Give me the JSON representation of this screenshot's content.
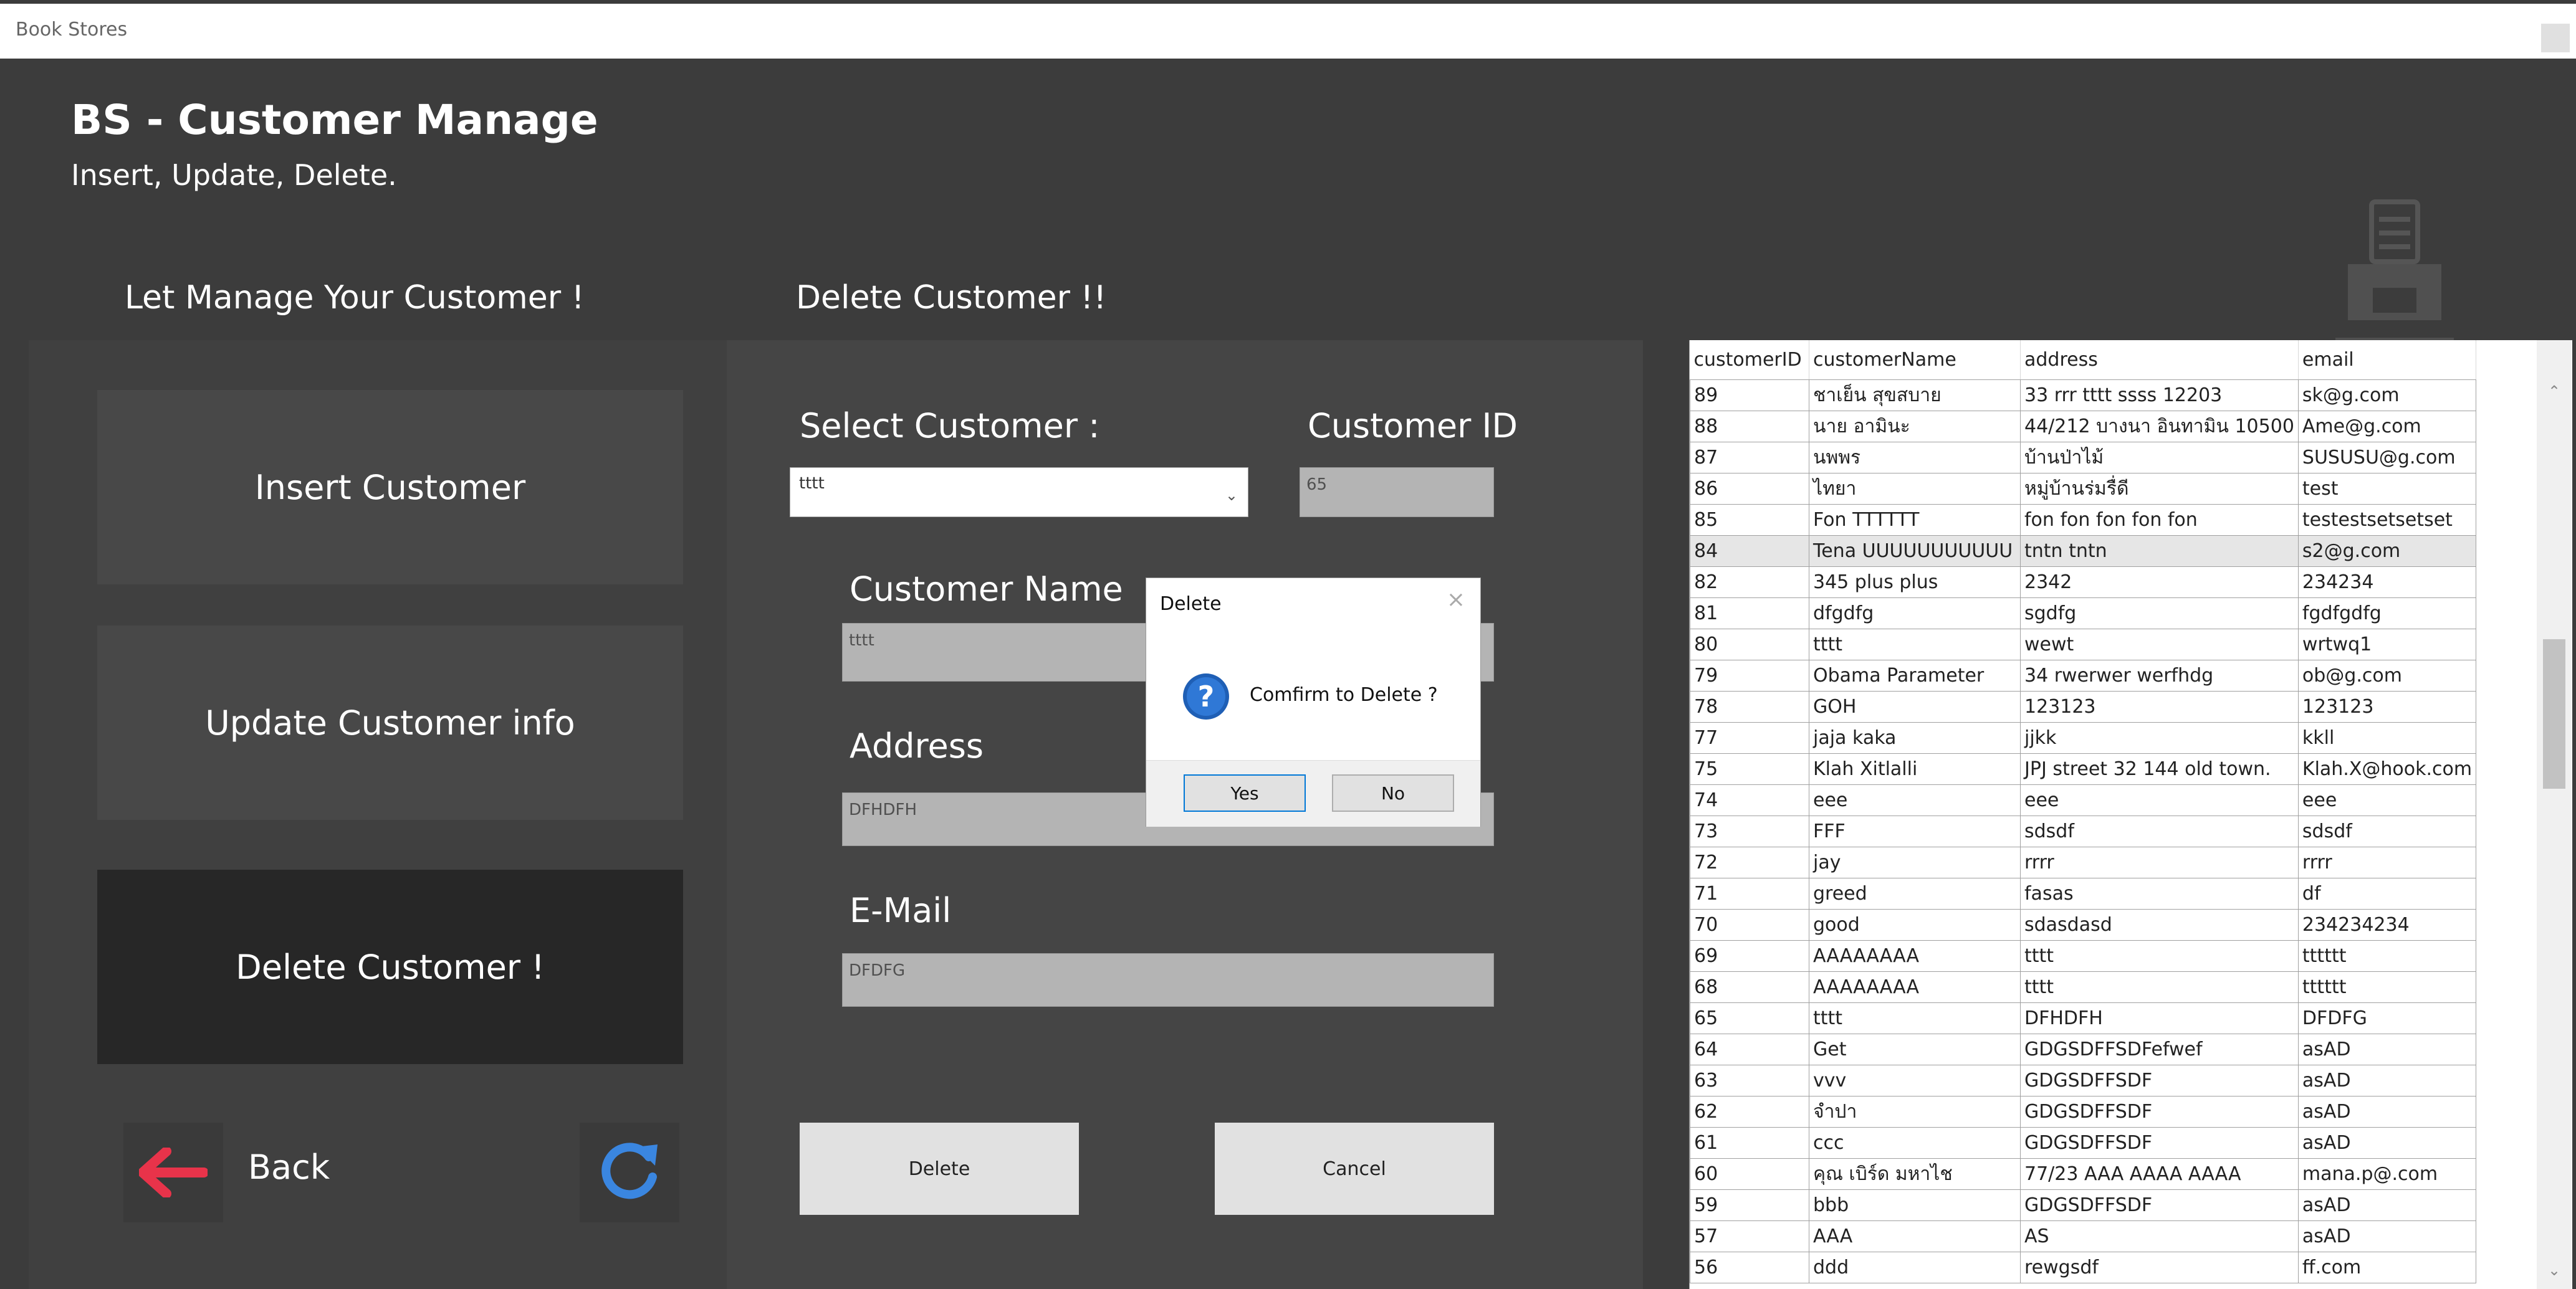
{
  "window": {
    "title": "Book Stores"
  },
  "header": {
    "title": "BS - Customer Manage",
    "subtitle": "Insert, Update, Delete."
  },
  "sections": {
    "left_heading": "Let Manage Your Customer !",
    "form_heading": "Delete Customer !!"
  },
  "menu": {
    "insert_label": "Insert Customer",
    "update_label": "Update Customer info",
    "delete_label": "Delete Customer !",
    "back_label": "Back"
  },
  "form": {
    "select_label": "Select Customer :",
    "select_value": "tttt",
    "id_label": "Customer ID",
    "id_value": "65",
    "name_label": "Customer Name",
    "name_value": "tttt",
    "address_label": "Address",
    "address_value": "DFHDFH",
    "email_label": "E-Mail",
    "email_value": "DFDFG",
    "delete_button": "Delete",
    "cancel_button": "Cancel"
  },
  "dialog": {
    "title": "Delete",
    "message": "Comfirm to Delete ?",
    "yes_label": "Yes",
    "no_label": "No"
  },
  "grid": {
    "columns": [
      "customerID",
      "customerName",
      "address",
      "email"
    ],
    "selected_index": 5,
    "rows": [
      [
        "89",
        "ชาเย็น สุขสบาย",
        "33 rrr tttt ssss 12203",
        "sk@g.com"
      ],
      [
        "88",
        "นาย อามินะ",
        "44/212 บางนา อินทามิน 10500",
        "Ame@g.com"
      ],
      [
        "87",
        "นพพร",
        "บ้านป่าไม้",
        "SUSUSU@g.com"
      ],
      [
        "86",
        "ไทยา",
        "หมู่บ้านร่มรื่ดี",
        "test"
      ],
      [
        "85",
        "Fon TTTTTT",
        "fon fon fon fon fon",
        "testestsetsetset"
      ],
      [
        "84",
        "Tena UUUUUUUUUUU",
        "tntn tntn",
        "s2@g.com"
      ],
      [
        "82",
        "345 plus plus",
        "2342",
        "234234"
      ],
      [
        "81",
        "dfgdfg",
        "sgdfg",
        "fgdfgdfg"
      ],
      [
        "80",
        "tttt",
        "wewt",
        "wrtwq1"
      ],
      [
        "79",
        "Obama Parameter",
        "34 rwerwer werfhdg",
        "ob@g.com"
      ],
      [
        "78",
        "GOH",
        "123123",
        "123123"
      ],
      [
        "77",
        "jaja kaka",
        "jjkk",
        "kkll"
      ],
      [
        "75",
        "Klah Xitlalli",
        "JPJ street 32 144 old town.",
        "Klah.X@hook.com"
      ],
      [
        "74",
        "eee",
        "eee",
        "eee"
      ],
      [
        "73",
        "FFF",
        "sdsdf",
        "sdsdf"
      ],
      [
        "72",
        "jay",
        "rrrr",
        "rrrr"
      ],
      [
        "71",
        "greed",
        "fasas",
        "df"
      ],
      [
        "70",
        "good",
        "sdasdasd",
        "234234234"
      ],
      [
        "69",
        "AAAAAAAA",
        "tttt",
        "tttttt"
      ],
      [
        "68",
        "AAAAAAAA",
        "tttt",
        "tttttt"
      ],
      [
        "65",
        "tttt",
        "DFHDFH",
        "DFDFG"
      ],
      [
        "64",
        "Get",
        "GDGSDFFSDFefwef",
        "asAD"
      ],
      [
        "63",
        "vvv",
        "GDGSDFFSDF",
        "asAD"
      ],
      [
        "62",
        "จำปา",
        "GDGSDFFSDF",
        "asAD"
      ],
      [
        "61",
        "ccc",
        "GDGSDFFSDF",
        "asAD"
      ],
      [
        "60",
        "คุณ เบิร์ด มหาไช",
        "77/23 AAA AAAA AAAA",
        "mana.p@.com"
      ],
      [
        "59",
        "bbb",
        "GDGSDFFSDF",
        "asAD"
      ],
      [
        "57",
        "AAA",
        "AS",
        "asAD"
      ],
      [
        "56",
        "ddd",
        "rewgsdf",
        "ff.com"
      ]
    ]
  },
  "colors": {
    "app_bg": "#3c3c3c",
    "active_menu": "#272727",
    "back_arrow": "#e8334a",
    "refresh_icon": "#3a86e0",
    "question_icon": "#1f5fb5"
  }
}
